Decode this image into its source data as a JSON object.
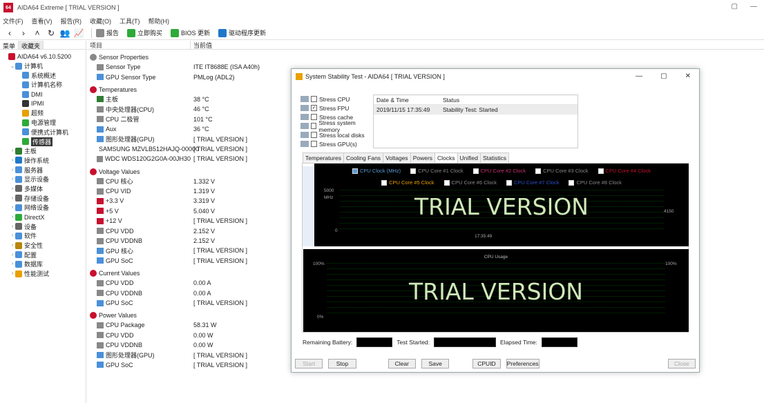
{
  "window": {
    "title": "AIDA64 Extreme  [ TRIAL VERSION ]",
    "icon_label": "64",
    "controls": [
      "▢",
      "—"
    ]
  },
  "menu": [
    "文件(F)",
    "查看(V)",
    "报告(R)",
    "收藏(O)",
    "工具(T)",
    "帮助(H)"
  ],
  "toolbar": {
    "nav": [
      "‹",
      "›",
      "˄",
      "↻",
      "👥",
      "📈"
    ],
    "buttons": [
      {
        "label": "报告",
        "icon": "report-icon",
        "color": "#8a8a8a"
      },
      {
        "label": "立即购买",
        "icon": "buy-icon",
        "color": "#2eaa3a"
      },
      {
        "label": "BIOS 更新",
        "icon": "bios-update-icon",
        "color": "#2eaa3a"
      },
      {
        "label": "驱动程序更新",
        "icon": "driver-update-icon",
        "color": "#1e78c8"
      }
    ]
  },
  "tree": {
    "tabs": [
      "菜单",
      "收藏夹"
    ],
    "items": [
      {
        "label": "AIDA64 v6.10.5200",
        "indent": 0,
        "exp": "",
        "color": "#c8102e"
      },
      {
        "label": "计算机",
        "indent": 1,
        "exp": "⌄",
        "color": "#4a90d9"
      },
      {
        "label": "系统概述",
        "indent": 2,
        "exp": "",
        "color": "#4a90d9"
      },
      {
        "label": "计算机名称",
        "indent": 2,
        "exp": "",
        "color": "#4a90d9"
      },
      {
        "label": "DMI",
        "indent": 2,
        "exp": "",
        "color": "#4a90d9"
      },
      {
        "label": "IPMI",
        "indent": 2,
        "exp": "",
        "color": "#333333"
      },
      {
        "label": "超频",
        "indent": 2,
        "exp": "",
        "color": "#e8a000"
      },
      {
        "label": "电源管理",
        "indent": 2,
        "exp": "",
        "color": "#2eaa3a"
      },
      {
        "label": "便携式计算机",
        "indent": 2,
        "exp": "",
        "color": "#4a90d9"
      },
      {
        "label": "传感器",
        "indent": 2,
        "exp": "",
        "color": "#2eaa3a",
        "selected": true
      },
      {
        "label": "主板",
        "indent": 1,
        "exp": "›",
        "color": "#2e7d32"
      },
      {
        "label": "操作系统",
        "indent": 1,
        "exp": "›",
        "color": "#1e78c8"
      },
      {
        "label": "服务器",
        "indent": 1,
        "exp": "›",
        "color": "#4a90d9"
      },
      {
        "label": "显示设备",
        "indent": 1,
        "exp": "›",
        "color": "#4a90d9"
      },
      {
        "label": "多媒体",
        "indent": 1,
        "exp": "›",
        "color": "#666666"
      },
      {
        "label": "存储设备",
        "indent": 1,
        "exp": "›",
        "color": "#666666"
      },
      {
        "label": "网络设备",
        "indent": 1,
        "exp": "›",
        "color": "#4a90d9"
      },
      {
        "label": "DirectX",
        "indent": 1,
        "exp": "›",
        "color": "#2eaa3a"
      },
      {
        "label": "设备",
        "indent": 1,
        "exp": "›",
        "color": "#666666"
      },
      {
        "label": "软件",
        "indent": 1,
        "exp": "›",
        "color": "#4a90d9"
      },
      {
        "label": "安全性",
        "indent": 1,
        "exp": "›",
        "color": "#b8860b"
      },
      {
        "label": "配置",
        "indent": 1,
        "exp": "›",
        "color": "#4a90d9"
      },
      {
        "label": "数据库",
        "indent": 1,
        "exp": "›",
        "color": "#4a90d9"
      },
      {
        "label": "性能测试",
        "indent": 1,
        "exp": "›",
        "color": "#e8a000"
      }
    ]
  },
  "list": {
    "headers": [
      "项目",
      "当前值"
    ],
    "groups": [
      {
        "title": "Sensor Properties",
        "icon_color": "#888888",
        "rows": [
          {
            "field": "Sensor Type",
            "value": "ITE IT8688E  (ISA A40h)",
            "icon_color": "#888888"
          },
          {
            "field": "GPU Sensor Type",
            "value": "PMLog  (ADL2)",
            "icon_color": "#4a90d9"
          }
        ]
      },
      {
        "title": "Temperatures",
        "icon_color": "#c8102e",
        "rows": [
          {
            "field": "主板",
            "value": "38 °C",
            "icon_color": "#2e7d32"
          },
          {
            "field": "中央处理器(CPU)",
            "value": "46 °C",
            "icon_color": "#888888"
          },
          {
            "field": "CPU 二极管",
            "value": "101 °C",
            "icon_color": "#888888"
          },
          {
            "field": "Aux",
            "value": "36 °C",
            "icon_color": "#4a90d9"
          },
          {
            "field": "图形处理器(GPU)",
            "value": "[ TRIAL VERSION ]",
            "icon_color": "#4a90d9"
          },
          {
            "field": "SAMSUNG MZVLB512HAJQ-00000",
            "value": "[ TRIAL VERSION ]",
            "icon_color": "#888888"
          },
          {
            "field": "WDC WDS120G2G0A-00JH30",
            "value": "[ TRIAL VERSION ]",
            "icon_color": "#888888"
          }
        ]
      },
      {
        "title": "Voltage Values",
        "icon_color": "#c8102e",
        "rows": [
          {
            "field": "CPU 核心",
            "value": "1.332 V",
            "icon_color": "#888888"
          },
          {
            "field": "CPU VID",
            "value": "1.319 V",
            "icon_color": "#888888"
          },
          {
            "field": "+3.3 V",
            "value": "3.319 V",
            "icon_color": "#c8102e"
          },
          {
            "field": "+5 V",
            "value": "5.040 V",
            "icon_color": "#c8102e"
          },
          {
            "field": "+12 V",
            "value": "[ TRIAL VERSION ]",
            "icon_color": "#c8102e"
          },
          {
            "field": "CPU VDD",
            "value": "2.152 V",
            "icon_color": "#888888"
          },
          {
            "field": "CPU VDDNB",
            "value": "2.152 V",
            "icon_color": "#888888"
          },
          {
            "field": "GPU 核心",
            "value": "[ TRIAL VERSION ]",
            "icon_color": "#4a90d9"
          },
          {
            "field": "GPU SoC",
            "value": "[ TRIAL VERSION ]",
            "icon_color": "#4a90d9"
          }
        ]
      },
      {
        "title": "Current Values",
        "icon_color": "#c8102e",
        "rows": [
          {
            "field": "CPU VDD",
            "value": "0.00 A",
            "icon_color": "#888888"
          },
          {
            "field": "CPU VDDNB",
            "value": "0.00 A",
            "icon_color": "#888888"
          },
          {
            "field": "GPU SoC",
            "value": "[ TRIAL VERSION ]",
            "icon_color": "#4a90d9"
          }
        ]
      },
      {
        "title": "Power Values",
        "icon_color": "#c8102e",
        "rows": [
          {
            "field": "CPU Package",
            "value": "58.31 W",
            "icon_color": "#888888"
          },
          {
            "field": "CPU VDD",
            "value": "0.00 W",
            "icon_color": "#888888"
          },
          {
            "field": "CPU VDDNB",
            "value": "0.00 W",
            "icon_color": "#888888"
          },
          {
            "field": "图形处理器(GPU)",
            "value": "[ TRIAL VERSION ]",
            "icon_color": "#4a90d9"
          },
          {
            "field": "GPU SoC",
            "value": "[ TRIAL VERSION ]",
            "icon_color": "#4a90d9"
          }
        ]
      }
    ]
  },
  "dialog": {
    "title": "System Stability Test - AIDA64  [ TRIAL VERSION ]",
    "controls": [
      "—",
      "▢",
      "✕"
    ],
    "checks": [
      {
        "label": "Stress CPU",
        "checked": false
      },
      {
        "label": "Stress FPU",
        "checked": true
      },
      {
        "label": "Stress cache",
        "checked": false
      },
      {
        "label": "Stress system memory",
        "checked": false
      },
      {
        "label": "Stress local disks",
        "checked": false
      },
      {
        "label": "Stress GPU(s)",
        "checked": false
      }
    ],
    "status": {
      "headers": [
        "Date & Time",
        "Status"
      ],
      "row": [
        "2019/11/15 17:35:49",
        "Stability Test: Started"
      ]
    },
    "tabs": [
      "Temperatures",
      "Cooling Fans",
      "Voltages",
      "Powers",
      "Clocks",
      "Unified",
      "Statistics"
    ],
    "active_tab": "Clocks",
    "legend1": [
      {
        "label": "CPU Clock (MHz)",
        "checked": true,
        "color": "#5b9bd5"
      },
      {
        "label": "CPU Core #1 Clock",
        "checked": false,
        "color": "#888888"
      },
      {
        "label": "CPU Core #2 Clock",
        "checked": false,
        "color": "#c83070"
      },
      {
        "label": "CPU Core #3 Clock",
        "checked": false,
        "color": "#888888"
      },
      {
        "label": "CPU Core #4 Clock",
        "checked": false,
        "color": "#c8102e"
      }
    ],
    "legend2": [
      {
        "label": "CPU Core #5 Clock",
        "checked": false,
        "color": "#e8a000"
      },
      {
        "label": "CPU Core #6 Clock",
        "checked": false,
        "color": "#888888"
      },
      {
        "label": "CPU Core #7 Clock",
        "checked": false,
        "color": "#3050c8"
      },
      {
        "label": "CPU Core #8 Clock",
        "checked": false,
        "color": "#888888"
      }
    ],
    "graph1": {
      "watermark": "TRIAL VERSION",
      "y_top": "5000",
      "y_mid": "MHz",
      "y_bottom": "0",
      "right_value": "4150",
      "x_label": "17:35:49"
    },
    "graph2": {
      "title": "CPU Usage",
      "watermark": "TRIAL VERSION",
      "y_top": "100%",
      "y_bottom": "0%",
      "right_value": "100%"
    },
    "info": {
      "remaining_label": "Remaining Battery:",
      "started_label": "Test Started:",
      "elapsed_label": "Elapsed Time:"
    },
    "buttons": [
      {
        "label": "Start",
        "disabled": true
      },
      {
        "label": "Stop",
        "disabled": false
      },
      {
        "label": "Clear",
        "disabled": false
      },
      {
        "label": "Save",
        "disabled": false
      },
      {
        "label": "CPUID",
        "disabled": false
      },
      {
        "label": "Preferences",
        "disabled": false
      },
      {
        "label": "Close",
        "disabled": true
      }
    ]
  }
}
